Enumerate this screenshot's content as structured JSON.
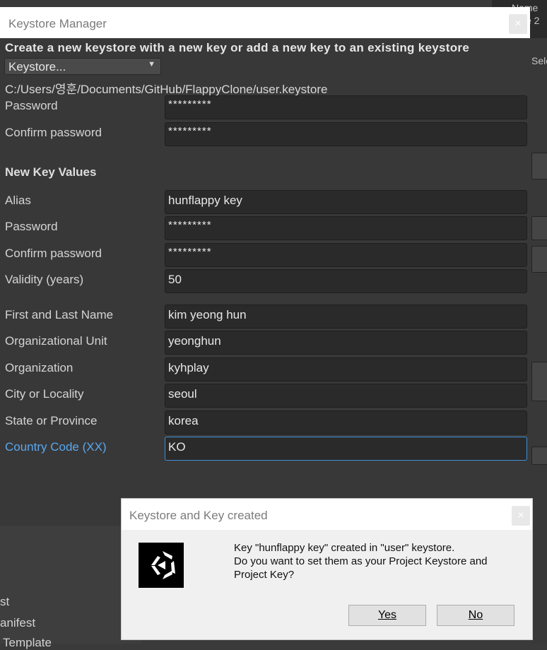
{
  "window": {
    "title": "Keystore Manager",
    "close_glyph": "×",
    "heading": "Create a new keystore with a new key or add a new key to an existing keystore",
    "keystore_dropdown": "Keystore...",
    "keystore_path": "C:/Users/영훈/Documents/GitHub/FlappyClone/user.keystore",
    "keystore_fields": [
      {
        "label": "Password",
        "value": "*********"
      },
      {
        "label": "Confirm password",
        "value": "*********"
      }
    ],
    "new_key_section": "New Key Values",
    "key_fields": [
      {
        "label": "Alias",
        "value": "hunflappy key"
      },
      {
        "label": "Password",
        "value": "*********"
      },
      {
        "label": "Confirm password",
        "value": "*********"
      },
      {
        "label": "Validity (years)",
        "value": "50"
      }
    ],
    "identity_fields": [
      {
        "label": "First and Last Name",
        "value": "kim yeong hun"
      },
      {
        "label": "Organizational Unit",
        "value": "yeonghun"
      },
      {
        "label": "Organization",
        "value": "kyhplay"
      },
      {
        "label": "City or Locality",
        "value": "seoul"
      },
      {
        "label": "State or Province",
        "value": "korea"
      },
      {
        "label": "Country Code (XX)",
        "value": "KO"
      }
    ]
  },
  "dialog": {
    "title": "Keystore and Key created",
    "close_glyph": "×",
    "message_line1": "Key \"hunflappy key\" created in \"user\" keystore.",
    "message_line2": "Do you want to set them as your Project Keystore and",
    "message_line3": "Project Key?",
    "yes_label": "Yes",
    "no_label": "No",
    "icon": "unity-logo-icon"
  },
  "background": {
    "top_right_line1": "Name",
    "top_right_line2": "e 2",
    "side_label": "Sele",
    "list_items": [
      "st",
      "anifest",
      "Template"
    ]
  },
  "colors": {
    "window_bg": "#383838",
    "field_bg": "#2a2a2a",
    "focus_accent": "#3d8fd8",
    "active_label": "#5aa7ef"
  }
}
